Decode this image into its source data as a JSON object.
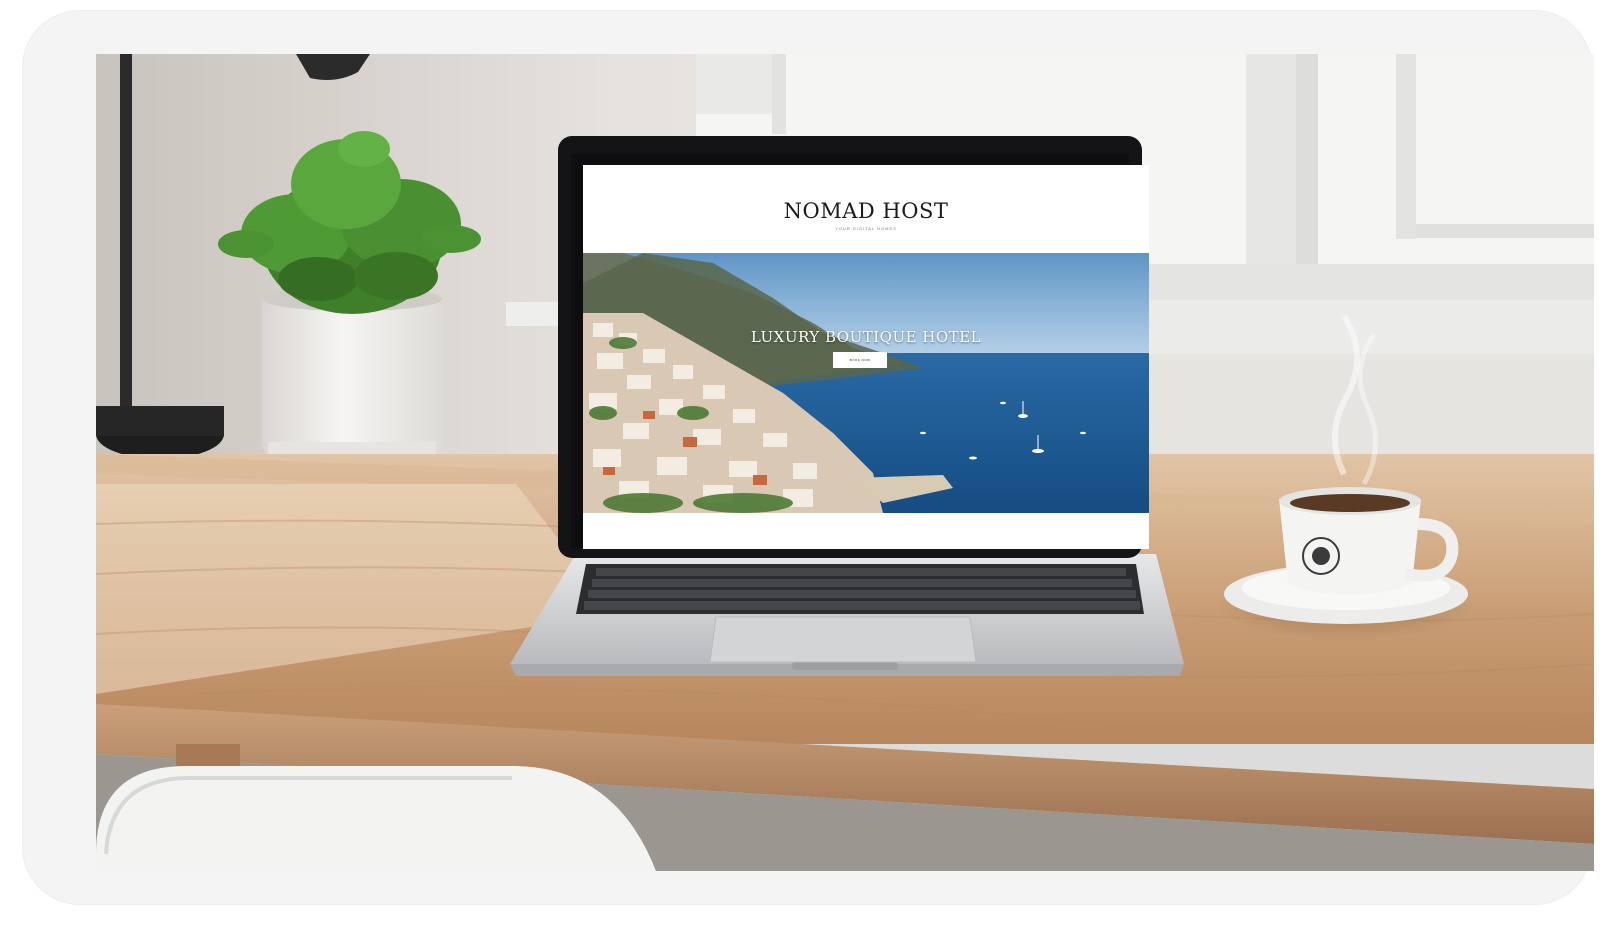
{
  "website": {
    "brand": "NOMAD HOST",
    "tagline": "YOUR DIGITAL HOMES",
    "hero_title": "LUXURY BOUTIQUE HOTEL",
    "cta_label": "BOOK NOW"
  },
  "colors": {
    "wall": "#e9e6e2",
    "desk_wood": "#c9a07a",
    "laptop_silver": "#cfd0d2",
    "sea": "#1f5f9a",
    "sky": "#7fb1d9",
    "plant_green": "#3f7f2a"
  }
}
